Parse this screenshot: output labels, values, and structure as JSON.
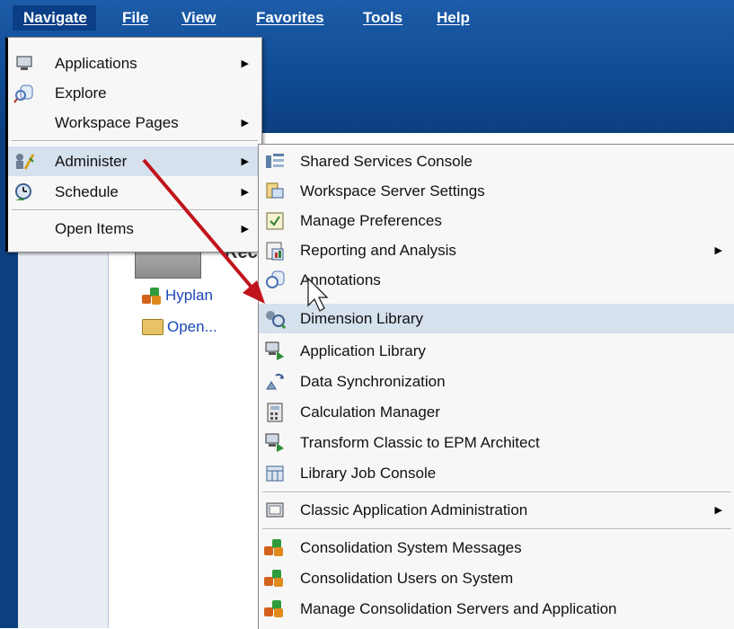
{
  "menubar": {
    "items": [
      "Navigate",
      "File",
      "View",
      "Favorites",
      "Tools",
      "Help"
    ]
  },
  "workspace": {
    "partial_heading": "Rec",
    "links": [
      "Hyplan",
      "Open..."
    ]
  },
  "navigate_menu": {
    "items": [
      "Applications",
      "Explore",
      "Workspace Pages",
      "Administer",
      "Schedule",
      "Open Items"
    ]
  },
  "administer_submenu": {
    "items": [
      "Shared Services Console",
      "Workspace Server Settings",
      "Manage Preferences",
      "Reporting and Analysis",
      "Annotations",
      "Dimension Library",
      "Application Library",
      "Data Synchronization",
      "Calculation Manager",
      "Transform Classic to EPM Architect",
      "Library Job Console",
      "Classic Application Administration",
      "Consolidation System Messages",
      "Consolidation Users on System",
      "Manage Consolidation Servers and Application"
    ]
  },
  "colors": {
    "header_blue": "#0f4a93",
    "highlight": "#d6e1ee",
    "annotation_arrow": "#c0141c"
  }
}
